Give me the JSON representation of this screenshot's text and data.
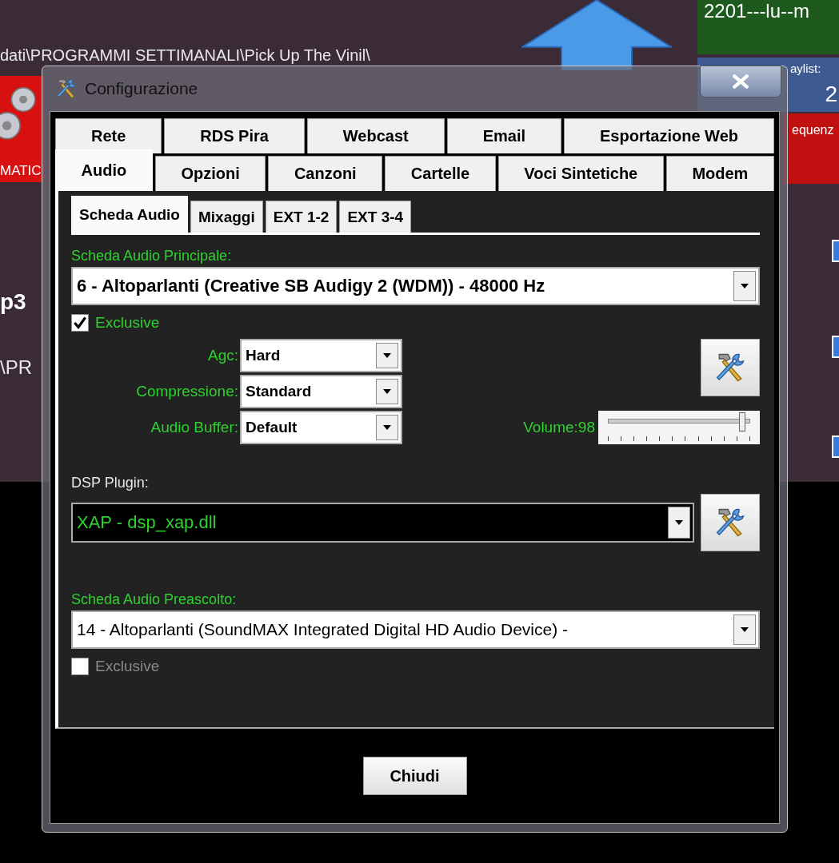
{
  "background": {
    "path_text": "dati\\PROGRAMMI SETTIMANALI\\Pick Up The Vinil\\",
    "left_panel_label": "MATIC",
    "top_right_title": "2201---lu--m",
    "playlist_label": "aylist:",
    "playlist_value": "2",
    "sequence_label": "equenz",
    "left_texts": [
      "p3",
      "\\PR"
    ]
  },
  "window": {
    "title": "Configurazione"
  },
  "tab_rows": [
    [
      {
        "label": "Rete",
        "selected": false
      },
      {
        "label": "RDS Pira",
        "selected": false
      },
      {
        "label": "Webcast",
        "selected": false
      },
      {
        "label": "Email",
        "selected": false
      },
      {
        "label": "Esportazione Web",
        "selected": false
      }
    ],
    [
      {
        "label": "Audio",
        "selected": true
      },
      {
        "label": "Opzioni",
        "selected": false
      },
      {
        "label": "Canzoni",
        "selected": false
      },
      {
        "label": "Cartelle",
        "selected": false
      },
      {
        "label": "Voci Sintetiche",
        "selected": false
      },
      {
        "label": "Modem",
        "selected": false
      }
    ]
  ],
  "subtabs": [
    {
      "label": "Scheda Audio",
      "selected": true
    },
    {
      "label": "Mixaggi",
      "selected": false
    },
    {
      "label": "EXT 1-2",
      "selected": false
    },
    {
      "label": "EXT 3-4",
      "selected": false
    }
  ],
  "main_card": {
    "label": "Scheda Audio Principale:",
    "value": "6 - Altoparlanti (Creative SB Audigy 2 (WDM)) - 48000 Hz"
  },
  "main_exclusive": {
    "label": "Exclusive",
    "checked": true
  },
  "settings": [
    {
      "label": "Agc:",
      "value": "Hard"
    },
    {
      "label": "Compressione:",
      "value": "Standard"
    },
    {
      "label": "Audio Buffer:",
      "value": "Default"
    }
  ],
  "volume": {
    "label": "Volume:98",
    "level": 0.95
  },
  "dsp": {
    "label": "DSP Plugin:",
    "value": "XAP - dsp_xap.dll"
  },
  "preview_card": {
    "label": "Scheda Audio Preascolto:",
    "value": "14 - Altoparlanti (SoundMAX Integrated Digital HD Audio Device) -"
  },
  "preview_exclusive": {
    "label": "Exclusive",
    "checked": false
  },
  "close_button": "Chiudi"
}
